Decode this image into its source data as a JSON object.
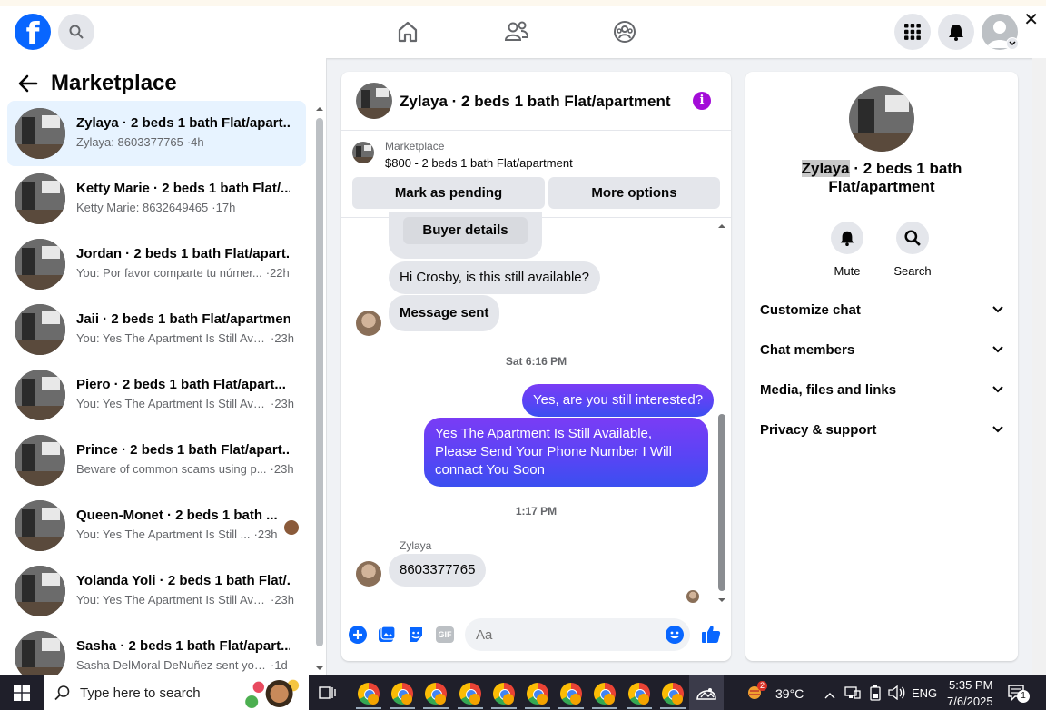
{
  "nav": {
    "logo": "f",
    "icons": [
      "search-icon",
      "home-icon",
      "friends-icon",
      "groups-icon",
      "menu-grid-icon",
      "notifications-icon",
      "profile-avatar-icon"
    ],
    "close": "✕"
  },
  "sidebar": {
    "title": "Marketplace",
    "conversations": [
      {
        "name": "Zylaya · 2 beds 1 bath Flat/apart...",
        "snippet": "Zylaya: 8603377765",
        "time": "·4h",
        "active": true
      },
      {
        "name": "Ketty Marie · 2 beds 1 bath Flat/...",
        "snippet": "Ketty Marie: 8632649465",
        "time": "·17h"
      },
      {
        "name": "Jordan · 2 beds 1 bath Flat/apart...",
        "snippet": "You: Por favor comparte tu númer...",
        "time": "·22h"
      },
      {
        "name": "Jaii · 2 beds 1 bath Flat/apartment",
        "snippet": "You: Yes The Apartment Is Still Ava...",
        "time": "·23h"
      },
      {
        "name": "Piero · 2 beds 1 bath Flat/apart...",
        "snippet": "You: Yes The Apartment Is Still Ava...",
        "time": "·23h"
      },
      {
        "name": "Prince · 2 beds 1 bath Flat/apart...",
        "snippet": "Beware of common scams using p...",
        "time": "·23h"
      },
      {
        "name": "Queen-Monet · 2 beds 1 bath ...",
        "snippet": "You: Yes The Apartment Is Still ...",
        "time": "·23h",
        "seen": true
      },
      {
        "name": "Yolanda Yoli · 2 beds 1 bath Flat/...",
        "snippet": "You: Yes The Apartment Is Still Ava...",
        "time": "·23h"
      },
      {
        "name": "Sasha · 2 beds 1 bath Flat/apart...",
        "snippet": "Sasha DelMoral DeNuñez sent you ...",
        "time": "·1d"
      }
    ]
  },
  "chat": {
    "title": "Zylaya · 2 beds 1 bath Flat/apartment",
    "marketplace_label": "Marketplace",
    "listing": "$800 - 2 beds 1 bath Flat/apartment",
    "mark_pending": "Mark as pending",
    "more_options": "More options",
    "buyer_details": "Buyer details",
    "messages": {
      "m1": "Hi Crosby, is this still available?",
      "m2": "Message sent",
      "ts1": "Sat 6:16 PM",
      "m3": "Yes, are you still interested?",
      "m4": "Yes The Apartment Is Still Available, Please Send Your Phone Number I Will connact You Soon",
      "ts2": "1:17 PM",
      "sender": "Zylaya",
      "m5": "8603377765"
    },
    "composer_placeholder": "Aa",
    "gif_label": "GIF"
  },
  "details": {
    "title_highlight": "Zylaya",
    "title_rest": " · 2 beds 1 bath Flat/apartment",
    "mute": "Mute",
    "search": "Search",
    "sections": [
      "Customize chat",
      "Chat members",
      "Media, files and links",
      "Privacy & support"
    ]
  },
  "taskbar": {
    "search_placeholder": "Type here to search",
    "weather_badge": "2",
    "temperature": "39°C",
    "language": "ENG",
    "time": "5:35 PM",
    "date": "7/6/2025",
    "notifications": "1"
  },
  "colors": {
    "brand": "#0866ff",
    "accent": "#a30cd8",
    "bubble_out": "#5a44f5"
  }
}
